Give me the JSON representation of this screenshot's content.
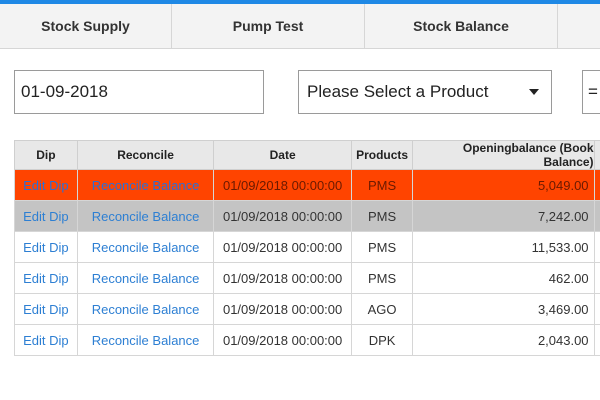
{
  "tabs": [
    {
      "label": "Stock Supply"
    },
    {
      "label": "Pump Test"
    },
    {
      "label": "Stock Balance"
    }
  ],
  "filters": {
    "date_value": "01-09-2018",
    "product_select_label": "Please Select a Product",
    "extra_select_label": "="
  },
  "table": {
    "headers": {
      "dip": "Dip",
      "reconcile": "Reconcile",
      "date": "Date",
      "products": "Products",
      "opening": "Openingbalance (Book Balance)"
    },
    "rows": [
      {
        "dip": "Edit Dip",
        "reconcile": "Reconcile Balance",
        "date": "01/09/2018 00:00:00",
        "product": "PMS",
        "opening": "5,049.00"
      },
      {
        "dip": "Edit Dip",
        "reconcile": "Reconcile Balance",
        "date": "01/09/2018 00:00:00",
        "product": "PMS",
        "opening": "7,242.00"
      },
      {
        "dip": "Edit Dip",
        "reconcile": "Reconcile Balance",
        "date": "01/09/2018 00:00:00",
        "product": "PMS",
        "opening": "11,533.00"
      },
      {
        "dip": "Edit Dip",
        "reconcile": "Reconcile Balance",
        "date": "01/09/2018 00:00:00",
        "product": "PMS",
        "opening": "462.00"
      },
      {
        "dip": "Edit Dip",
        "reconcile": "Reconcile Balance",
        "date": "01/09/2018 00:00:00",
        "product": "AGO",
        "opening": "3,469.00"
      },
      {
        "dip": "Edit Dip",
        "reconcile": "Reconcile Balance",
        "date": "01/09/2018 00:00:00",
        "product": "DPK",
        "opening": "2,043.00"
      }
    ]
  },
  "colors": {
    "accent": "#1e88e5",
    "highlight_row": "#ff4400",
    "selected_row": "#c4c4c4",
    "link": "#2d7fd3"
  }
}
